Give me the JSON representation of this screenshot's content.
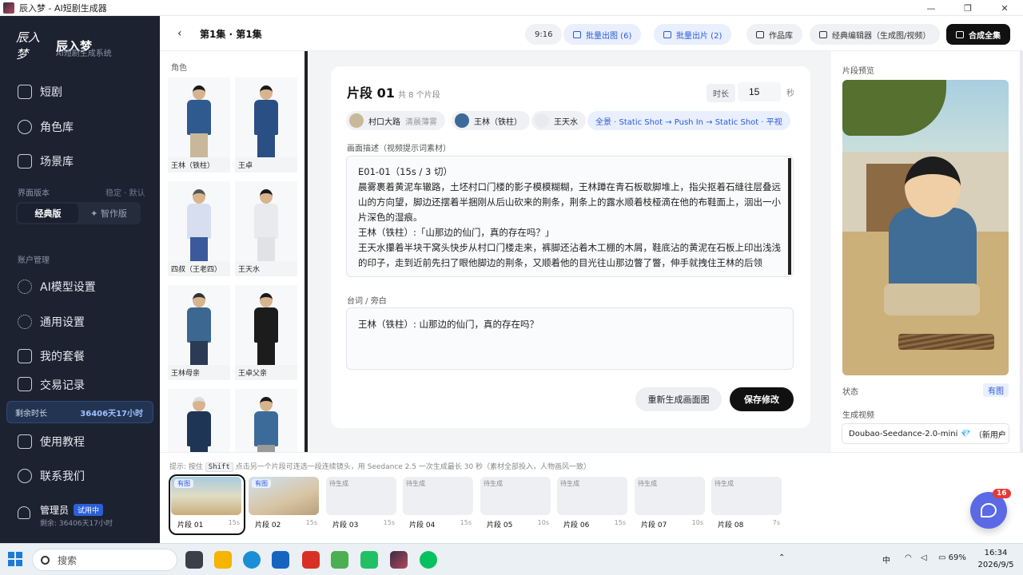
{
  "window": {
    "title": "辰入梦 - AI短剧生成器",
    "controls": [
      "—",
      "❐",
      "✕"
    ]
  },
  "sidebar": {
    "logo_text": "辰入梦",
    "brand_name": "辰入梦",
    "brand_sub": "AI短剧生成系统",
    "nav": [
      "短剧",
      "角色库",
      "场景库"
    ],
    "version_label": "界面版本",
    "version_hint": "稳定 · 默认",
    "version_classic": "经典版",
    "version_smart": "✦ 智作版",
    "account_label": "账户管理",
    "account_nav": [
      "AI模型设置",
      "通用设置",
      "我的套餐",
      "交易记录"
    ],
    "remaining_label": "剩余时长",
    "remaining_value": "36406天17小时",
    "bottom_nav": [
      "使用教程",
      "联系我们"
    ],
    "user_name": "管理员",
    "user_badge": "试用中",
    "user_remaining": "剩余: 36406天17小时"
  },
  "header": {
    "back": "‹",
    "episode_title": "第1集 · 第1集",
    "ratio": "9:16",
    "batch_image": "批量出图 (6)",
    "batch_video": "批量出片 (2)",
    "library": "作品库",
    "editor": "经典编辑器（生成图/视频）",
    "compose": "合成全集"
  },
  "characters": {
    "label": "角色",
    "items": [
      {
        "name": "王林（铁柱）"
      },
      {
        "name": "王卓"
      },
      {
        "name": "四叔（王老四）"
      },
      {
        "name": "王天水"
      },
      {
        "name": "王林母亲"
      },
      {
        "name": "王卓父亲"
      },
      {
        "name": ""
      },
      {
        "name": ""
      }
    ]
  },
  "segment": {
    "title": "片段 01",
    "count": "共 8 个片段",
    "duration_label": "时长",
    "duration_value": "15",
    "duration_unit": "秒",
    "tags": {
      "scene": "村口大路",
      "scene_sub": "清晨薄雾",
      "char1": "王林（铁柱）",
      "char2": "王天水",
      "shot": "全景 · Static Shot → Push In → Static Shot · 平视"
    },
    "desc_label": "画面描述（视频提示词素材）",
    "desc_lines": [
      "E01-01（15s / 3 切）",
      "晨雾裹着黄泥车辙路，土坯村口门楼的影子模模糊糊，王林蹲在青石板歇脚堆上，指尖抠着石缝往层叠远山的方向望，脚边还摆着半捆刚从后山砍来的荆条，荆条上的露水顺着枝桠滴在他的布鞋面上，洇出一小片深色的湿痕。",
      "王林（铁柱）:「山那边的仙门，真的存在吗？」",
      "王天水攥着半块干窝头快步从村口门楼走来，裤脚还沾着木工棚的木屑，鞋底沾的黄泥在石板上印出浅浅的印子，走到近前先扫了眼他脚边的荆条，又顺着他的目光往山那边瞥了瞥，伸手就拽住王林的后领"
    ],
    "dialog_label": "台词 / 旁白",
    "dialog_text": "王林（铁柱）: 山那边的仙门，真的存在吗？",
    "regen_button": "重新生成画面图",
    "save_button": "保存修改"
  },
  "preview": {
    "label": "片段预览",
    "status_label": "状态",
    "status_value": "有图",
    "gen_label": "生成视频",
    "model_name": "Doubao-Seedance-2.0-mini",
    "model_tag": "（新用户",
    "gem": "💎"
  },
  "strip": {
    "hint_prefix": "提示: 按住",
    "hint_key": "Shift",
    "hint_suffix": "点击另一个片段可连选一段连续镜头，用 Seedance 2.5 一次生成最长 30 秒（素材全部投入，人物画风一致）",
    "thumbs": [
      {
        "status": "有图",
        "name": "片段 01",
        "dur": "15s"
      },
      {
        "status": "有图",
        "name": "片段 02",
        "dur": "15s"
      },
      {
        "status": "待生成",
        "name": "片段 03",
        "dur": "15s"
      },
      {
        "status": "待生成",
        "name": "片段 04",
        "dur": "15s"
      },
      {
        "status": "待生成",
        "name": "片段 05",
        "dur": "10s"
      },
      {
        "status": "待生成",
        "name": "片段 06",
        "dur": "15s"
      },
      {
        "status": "待生成",
        "name": "片段 07",
        "dur": "10s"
      },
      {
        "status": "待生成",
        "name": "片段 08",
        "dur": "7s"
      }
    ],
    "chat_count": "16"
  },
  "taskbar": {
    "search_placeholder": "搜索",
    "ime": "中",
    "battery": "69%",
    "time": "16:34",
    "date": "2026/9/5"
  },
  "colors": {
    "sidebar_bg": "#1c2230",
    "accent_blue": "#2a5bd7",
    "primary_dark": "#111111",
    "chat_fab": "#5b69e6"
  }
}
